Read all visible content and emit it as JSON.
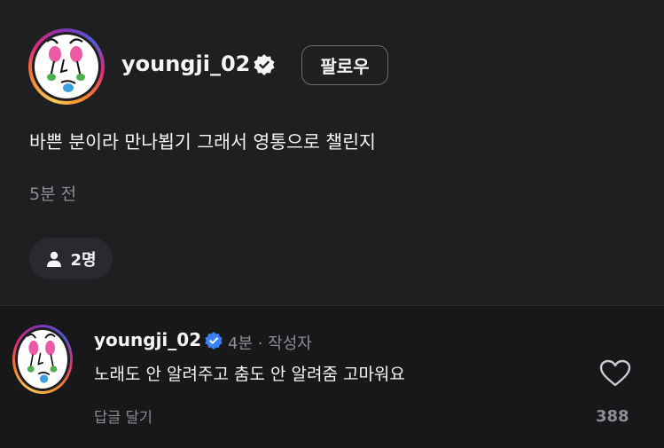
{
  "post": {
    "username": "youngji_02",
    "follow_label": "팔로우",
    "text": "바쁜 분이라 만나뵙기 그래서 영통으로 챌린지",
    "time": "5분 전",
    "people_count": "2명"
  },
  "comment": {
    "username": "youngji_02",
    "meta": "4분 · 작성자",
    "text": "노래도 안 알려주고 춤도 안 알려줌 고마워요",
    "reply_label": "답글 달기",
    "like_count": "388"
  },
  "colors": {
    "background": "#18181a",
    "post_background": "#1f1f22",
    "verified_blue": "#3b82f6",
    "muted_text": "#8c8c92"
  },
  "icons": [
    "verified-badge-icon",
    "person-icon",
    "heart-icon",
    "verified-check-icon"
  ]
}
